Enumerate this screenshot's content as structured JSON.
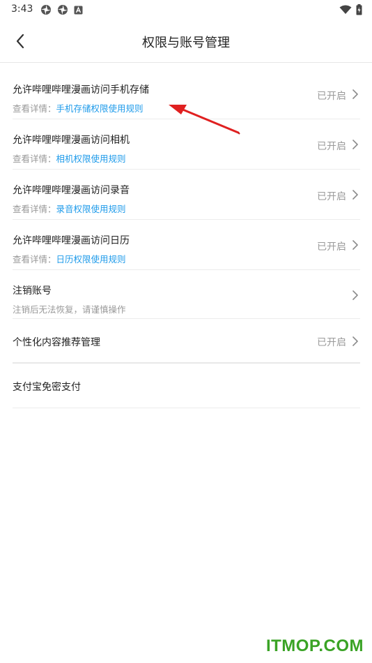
{
  "status_bar": {
    "time": "3:43",
    "left_icons": [
      "app-notification-icon",
      "app-notification-icon",
      "a-letter-icon"
    ],
    "right_icons": [
      "wifi-icon",
      "battery-icon"
    ]
  },
  "header": {
    "back_icon": "chevron-left-icon",
    "title": "权限与账号管理"
  },
  "settings": {
    "items": [
      {
        "title": "允许哔哩哔哩漫画访问手机存储",
        "sub_prefix": "查看详情：",
        "sub_link": "手机存储权限使用规则",
        "status": "已开启",
        "chevron": "chevron-right-icon"
      },
      {
        "title": "允许哔哩哔哩漫画访问相机",
        "sub_prefix": "查看详情：",
        "sub_link": "相机权限使用规则",
        "status": "已开启",
        "chevron": "chevron-right-icon"
      },
      {
        "title": "允许哔哩哔哩漫画访问录音",
        "sub_prefix": "查看详情：",
        "sub_link": "录音权限使用规则",
        "status": "已开启",
        "chevron": "chevron-right-icon"
      },
      {
        "title": "允许哔哩哔哩漫画访问日历",
        "sub_prefix": "查看详情：",
        "sub_link": "日历权限使用规则",
        "status": "已开启",
        "chevron": "chevron-right-icon"
      },
      {
        "title": "注销账号",
        "sub_note": "注销后无法恢复，请谨慎操作",
        "chevron": "chevron-right-icon"
      },
      {
        "title": "个性化内容推荐管理",
        "status": "已开启",
        "chevron": "chevron-right-icon"
      },
      {
        "title": "支付宝免密支付"
      }
    ]
  },
  "annotation": {
    "arrow_color": "#e02020",
    "icon": "red-arrow-icon"
  },
  "watermark": {
    "text": "ITMOP.COM",
    "color": "#3aa325"
  },
  "colors": {
    "link": "#1f9bea",
    "status": "#9a9a9a",
    "divider": "#ececec"
  }
}
